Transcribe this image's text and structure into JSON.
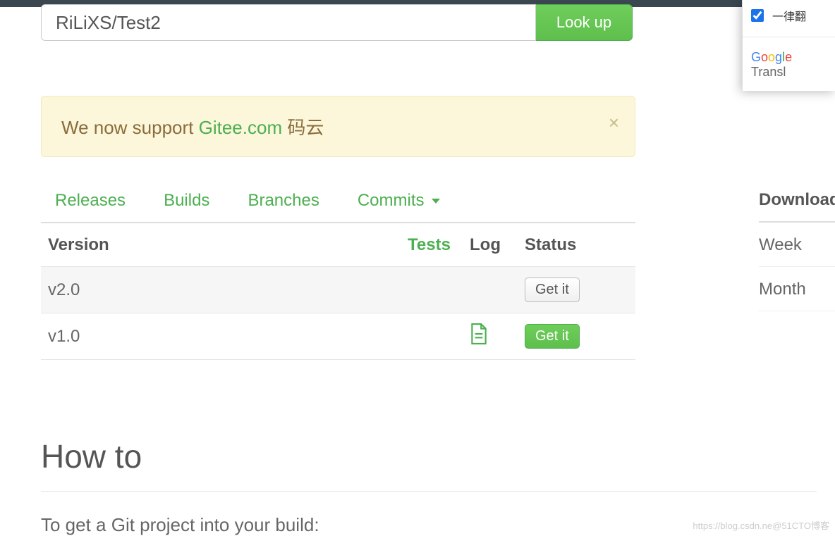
{
  "search": {
    "value": "RiLiXS/Test2",
    "button": "Look up"
  },
  "alert": {
    "prefix": "We now support ",
    "link": "Gitee.com",
    "suffix": " 码云",
    "close": "×"
  },
  "tabs": [
    "Releases",
    "Builds",
    "Branches",
    "Commits"
  ],
  "columns": {
    "version": "Version",
    "tests": "Tests",
    "log": "Log",
    "status": "Status"
  },
  "rows": [
    {
      "version": "v2.0",
      "has_log": false,
      "button_style": "default",
      "button": "Get it"
    },
    {
      "version": "v1.0",
      "has_log": true,
      "button_style": "success",
      "button": "Get it"
    }
  ],
  "howto": {
    "title": "How to",
    "subtitle": "To get a Git project into your build:"
  },
  "right": {
    "heading": "Download",
    "items": [
      "Week",
      "Month"
    ]
  },
  "translate_panel": {
    "checkbox_label": "一律翻",
    "brand_prefix": "Google",
    "brand_suffix": " Transl"
  },
  "watermark": "https://blog.csdn.ne@51CTO博客"
}
